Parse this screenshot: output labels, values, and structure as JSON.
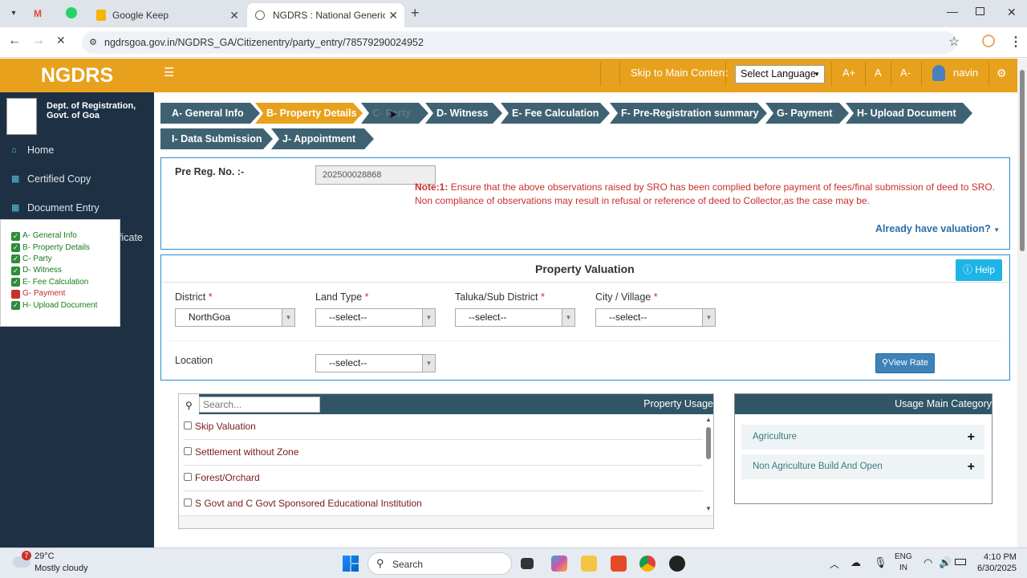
{
  "browser": {
    "tabs": [
      {
        "label": "Google Keep"
      },
      {
        "label": "NGDRS : National Generic Docu"
      }
    ],
    "url": "ngdrsgoa.gov.in/NGDRS_GA/Citizenentry/party_entry/78579290024952"
  },
  "app": {
    "logo": "NGDRS",
    "skip_link": "Skip to Main Content",
    "language": "Select Language",
    "font_plus": "A+",
    "font_normal": "A",
    "font_minus": "A-",
    "user": "navin"
  },
  "sidebar": {
    "dept_line1": "Dept. of Registration,",
    "dept_line2": "Govt. of Goa",
    "items": [
      {
        "label": "Home"
      },
      {
        "label": "Certified Copy"
      },
      {
        "label": "Document Entry"
      },
      {
        "label": "ficate"
      }
    ]
  },
  "progress": [
    {
      "label": "A- General Info",
      "status": "done"
    },
    {
      "label": "B- Property Details",
      "status": "done"
    },
    {
      "label": "C- Party",
      "status": "done"
    },
    {
      "label": "D- Witness",
      "status": "done"
    },
    {
      "label": "E- Fee Calculation",
      "status": "done"
    },
    {
      "label": "G- Payment",
      "status": "pending"
    },
    {
      "label": "H- Upload Document",
      "status": "done"
    }
  ],
  "steps": [
    {
      "label": "A- General Info"
    },
    {
      "label": "B- Property Details"
    },
    {
      "label": "C- Party"
    },
    {
      "label": "D- Witness"
    },
    {
      "label": "E- Fee Calculation"
    },
    {
      "label": "F- Pre-Registration summary"
    },
    {
      "label": "G- Payment"
    },
    {
      "label": "H- Upload Document"
    },
    {
      "label": "I- Data Submission"
    },
    {
      "label": "J- Appointment"
    }
  ],
  "prereg": {
    "label": "Pre Reg. No. :-",
    "value": "202500028868",
    "note_title": "Note:1:",
    "note_line1": "Ensure that the above observations raised by SRO has been complied before payment of fees/final submission of deed to SRO.",
    "note_line2": "Non compliance of observations may result in refusal or reference of deed to Collector,as the case may be.",
    "valuation_link": "Already have valuation?"
  },
  "valuation": {
    "title": "Property Valuation",
    "help": "Help",
    "district_label": "District",
    "district_value": "NorthGoa",
    "landtype_label": "Land Type",
    "landtype_value": "--select--",
    "taluka_label": "Taluka/Sub District",
    "taluka_value": "--select--",
    "city_label": "City / Village",
    "city_value": "--select--",
    "location_label": "Location",
    "location_value": "--select--",
    "view_rate": "View Rate"
  },
  "usage": {
    "search_placeholder": "Search...",
    "header": "Property Usage",
    "items": [
      {
        "label": "Skip Valuation"
      },
      {
        "label": "Settlement without Zone"
      },
      {
        "label": "Forest/Orchard"
      },
      {
        "label": "S Govt and C Govt Sponsored Educational Institution"
      }
    ],
    "main_header": "Usage Main Category",
    "categories": [
      {
        "label": "Agriculture"
      },
      {
        "label": "Non Agriculture Build And Open"
      }
    ]
  },
  "taskbar": {
    "temp": "29°C",
    "weather": "Mostly cloudy",
    "search": "Search",
    "lang1": "ENG",
    "lang2": "IN",
    "time": "4:10 PM",
    "date": "6/30/2025",
    "badge": "7"
  },
  "colors": {
    "accent": "#e8a11c",
    "sidebar": "#1e3144",
    "step": "#3f6273",
    "note": "#c9302c"
  }
}
